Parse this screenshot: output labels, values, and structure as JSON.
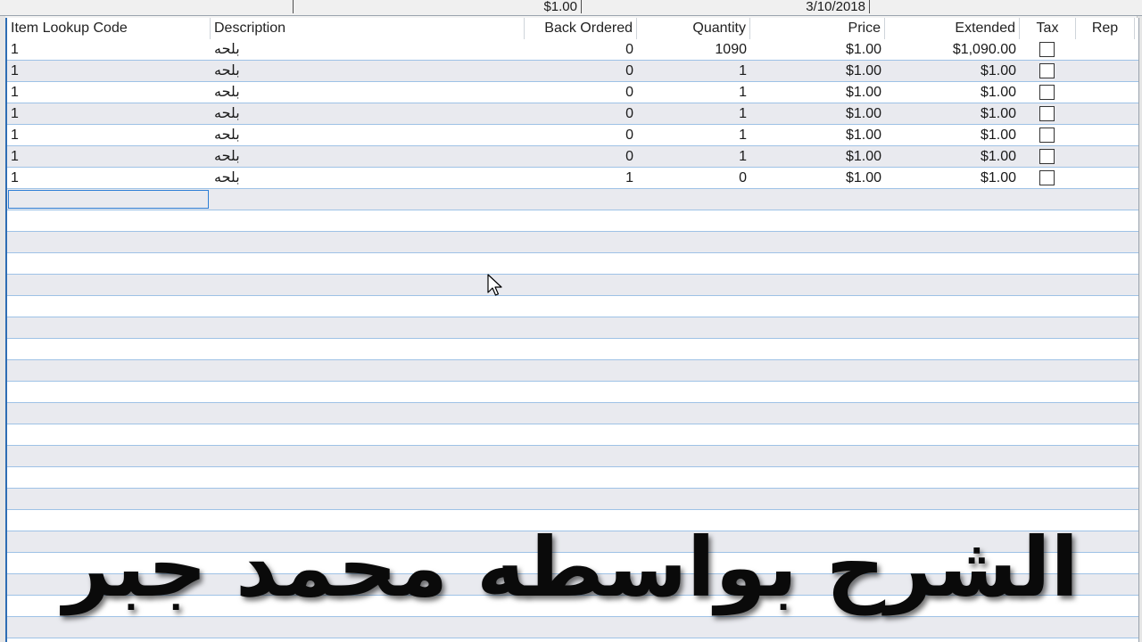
{
  "top_status": {
    "amount": "$1.00",
    "date": "3/10/2018"
  },
  "grid": {
    "columns": [
      {
        "label": "Item Lookup Code"
      },
      {
        "label": "Description"
      },
      {
        "label": "Back Ordered"
      },
      {
        "label": "Quantity"
      },
      {
        "label": "Price"
      },
      {
        "label": "Extended"
      },
      {
        "label": "Tax"
      },
      {
        "label": "Rep"
      }
    ],
    "rows": [
      {
        "code": "1",
        "description": "بلحه",
        "back_ordered": "0",
        "quantity": "1090",
        "price": "$1.00",
        "extended": "$1,090.00",
        "tax": false,
        "rep": ""
      },
      {
        "code": "1",
        "description": "بلحه",
        "back_ordered": "0",
        "quantity": "1",
        "price": "$1.00",
        "extended": "$1.00",
        "tax": false,
        "rep": ""
      },
      {
        "code": "1",
        "description": "بلحه",
        "back_ordered": "0",
        "quantity": "1",
        "price": "$1.00",
        "extended": "$1.00",
        "tax": false,
        "rep": ""
      },
      {
        "code": "1",
        "description": "بلحه",
        "back_ordered": "0",
        "quantity": "1",
        "price": "$1.00",
        "extended": "$1.00",
        "tax": false,
        "rep": ""
      },
      {
        "code": "1",
        "description": "بلحه",
        "back_ordered": "0",
        "quantity": "1",
        "price": "$1.00",
        "extended": "$1.00",
        "tax": false,
        "rep": ""
      },
      {
        "code": "1",
        "description": "بلحه",
        "back_ordered": "0",
        "quantity": "1",
        "price": "$1.00",
        "extended": "$1.00",
        "tax": false,
        "rep": ""
      },
      {
        "code": "1",
        "description": "بلحه",
        "back_ordered": "1",
        "quantity": "0",
        "price": "$1.00",
        "extended": "$1.00",
        "tax": false,
        "rep": ""
      }
    ]
  },
  "caption": {
    "text": "الشرح بواسطه محمد جبر"
  },
  "colors": {
    "row_even": "#e9eaef",
    "row_odd": "#ffffff",
    "row_line": "#9ec2e6",
    "selection": "#2e7fd6"
  }
}
